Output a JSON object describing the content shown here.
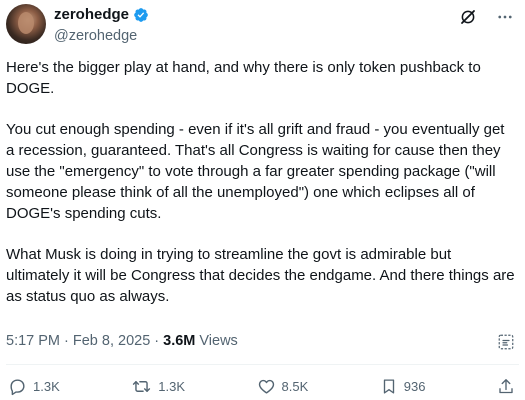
{
  "author": {
    "display_name": "zerohedge",
    "handle": "@zerohedge",
    "verified_badge_color": "#1d9bf0"
  },
  "post": {
    "paragraphs": [
      "Here's the bigger play at hand, and why there is only token pushback to DOGE.",
      "You cut enough spending - even if it's all grift and fraud - you eventually get a recession, guaranteed. That's all Congress is waiting for cause then they use the \"emergency\" to vote through a far greater spending package (\"will someone please think of all the unemployed\") one which eclipses all of DOGE's spending cuts.",
      "What Musk is doing in trying to streamline the govt is admirable but ultimately it will be Congress that decides the endgame. And there things are as status quo as always."
    ],
    "timestamp": "5:17 PM · Feb 8, 2025 · ",
    "views_count": "3.6M",
    "views_label": "Views"
  },
  "actions": {
    "replies": "1.3K",
    "reposts": "1.3K",
    "likes": "8.5K",
    "bookmarks": "936"
  },
  "icons": {
    "top": [
      "grok-icon",
      "more-icon"
    ],
    "meta": [
      "grok-analyze-icon"
    ],
    "actions": [
      "reply-icon",
      "repost-icon",
      "like-icon",
      "bookmark-icon",
      "share-icon"
    ]
  },
  "colors": {
    "text": "#0f1419",
    "secondary": "#536471",
    "verified": "#1d9bf0"
  }
}
